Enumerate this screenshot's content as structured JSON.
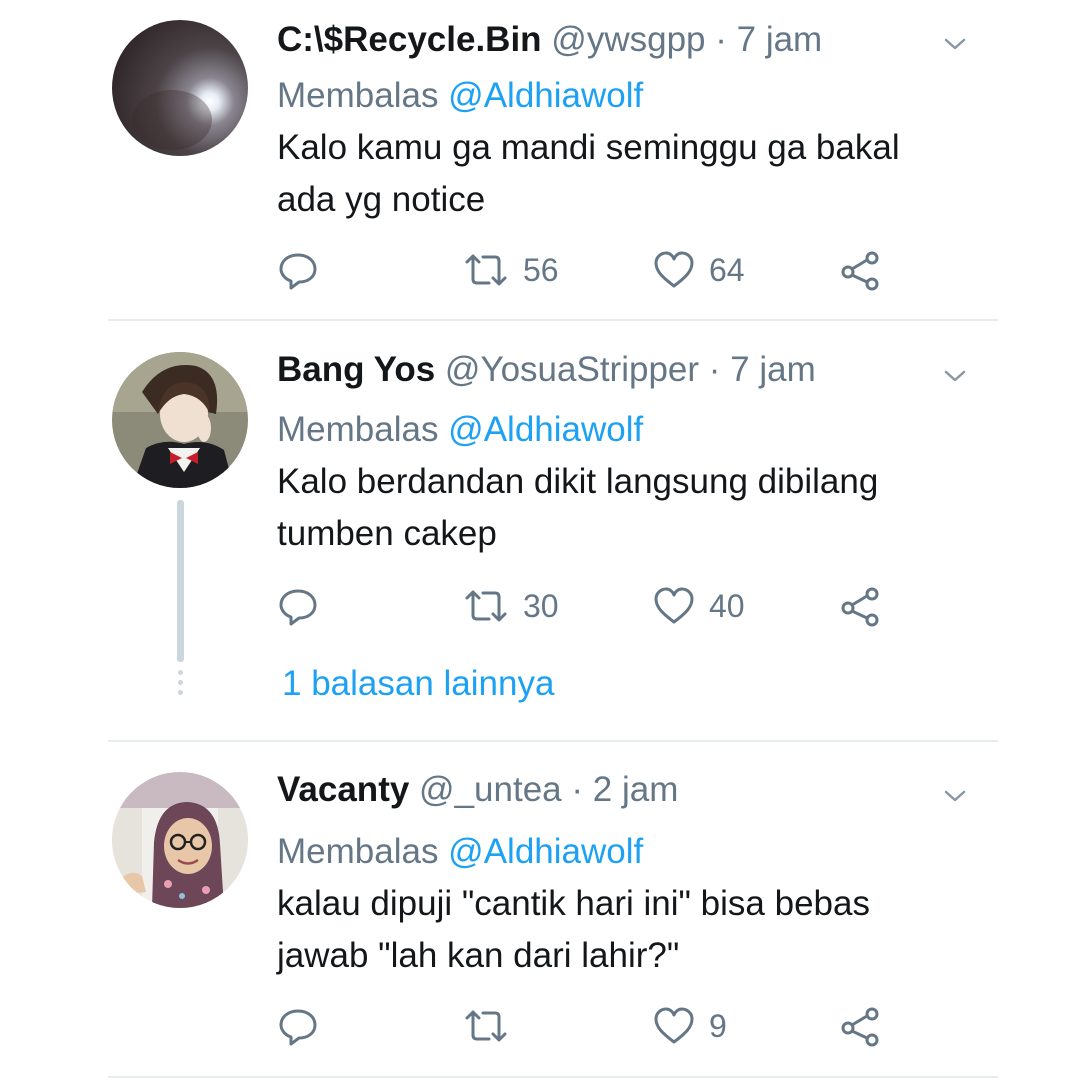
{
  "tweets": [
    {
      "name": "C:\\$Recycle.Bin",
      "handle": "@ywsgpp",
      "separator": "·",
      "time": "7 jam",
      "reply_prefix": "Membalas ",
      "reply_to": "@Aldhiawolf",
      "text": "Kalo kamu ga mandi seminggu ga bakal\nada yg notice",
      "retweets": "56",
      "likes": "64"
    },
    {
      "name": "Bang Yos",
      "handle": "@YosuaStripper",
      "separator": "·",
      "time": "7 jam",
      "reply_prefix": "Membalas ",
      "reply_to": "@Aldhiawolf",
      "text": "Kalo berdandan dikit langsung dibilang\ntumben cakep",
      "retweets": "30",
      "likes": "40",
      "more_replies": "1 balasan lainnya"
    },
    {
      "name": "Vacanty",
      "handle": "@_untea",
      "separator": "·",
      "time": "2 jam",
      "reply_prefix": "Membalas ",
      "reply_to": "@Aldhiawolf",
      "text": "kalau dipuji \"cantik hari ini\" bisa bebas\njawab \"lah kan dari lahir?\"",
      "retweets": "",
      "likes": "9"
    }
  ],
  "colors": {
    "text": "#14171a",
    "secondary": "#657786",
    "link": "#1da1f2",
    "divider": "#e6ecf0",
    "thread_line": "#ccd6dd"
  },
  "icons": [
    "reply-icon",
    "retweet-icon",
    "like-icon",
    "share-icon",
    "chevron-down-icon"
  ]
}
